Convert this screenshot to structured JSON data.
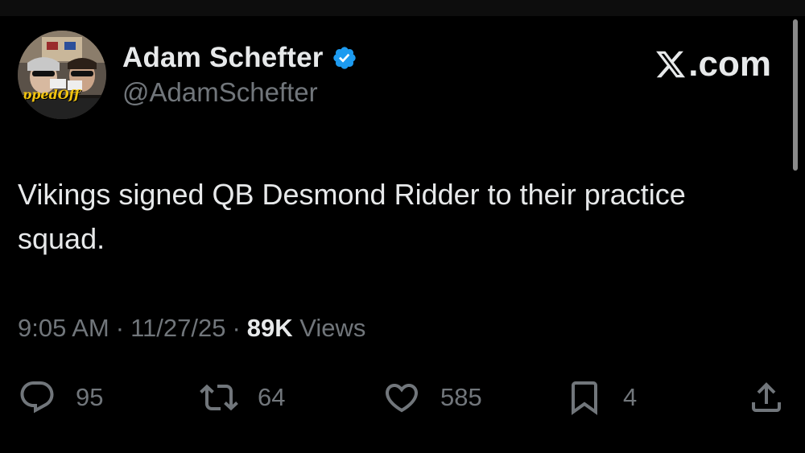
{
  "author": {
    "display_name": "Adam Schefter",
    "handle": "@AdamSchefter",
    "verified": true,
    "avatar_caption": "ppedOff"
  },
  "source": {
    "label": ".com",
    "logo_icon": "x-logo-icon"
  },
  "tweet": {
    "text": "Vikings signed QB Desmond Ridder to their practice squad."
  },
  "meta": {
    "time": "9:05 AM",
    "separator": "·",
    "date": "11/27/25",
    "views_count": "89K",
    "views_label": "Views"
  },
  "actions": {
    "replies": "95",
    "reposts": "64",
    "likes": "585",
    "bookmarks": "4"
  },
  "colors": {
    "background": "#000000",
    "text_primary": "#e7e9ea",
    "text_secondary": "#71767b",
    "verified_blue": "#1d9bf0"
  }
}
